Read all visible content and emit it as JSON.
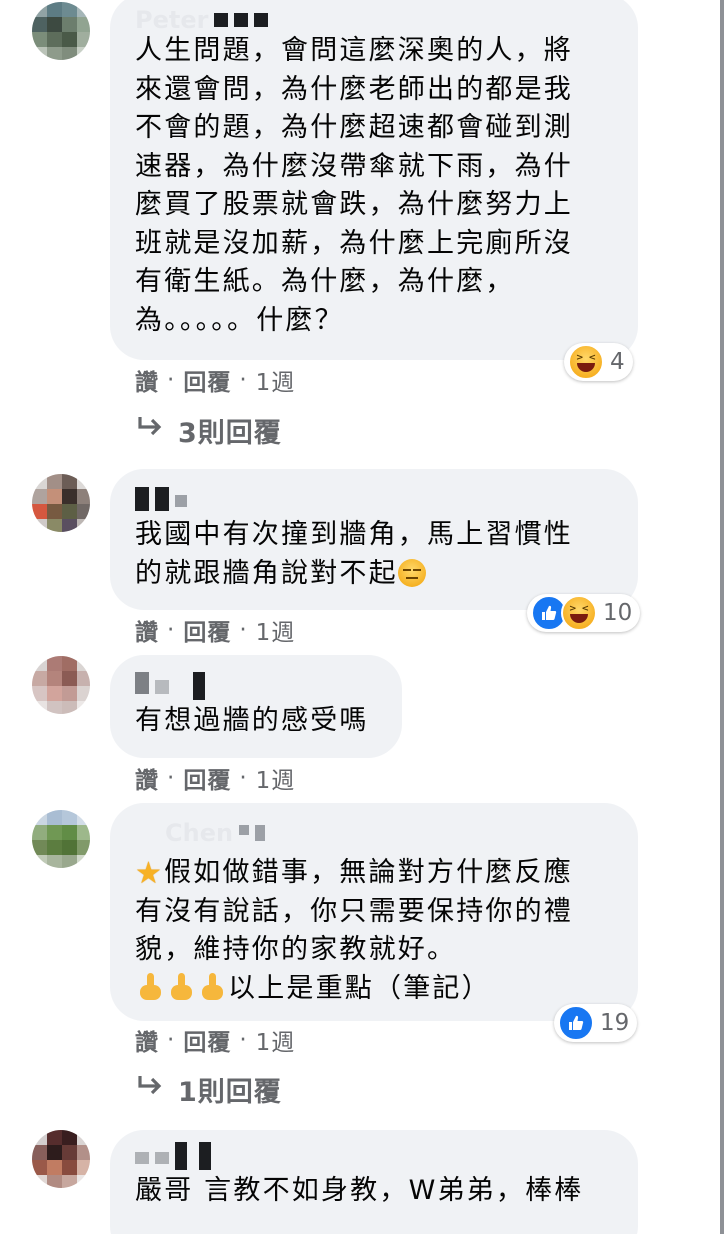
{
  "comments": [
    {
      "id": "c1",
      "name": "Peter",
      "text": "人生問題，會問這麼深奧的人，將\n來還會問，為什麼老師出的都是我\n不會的題，為什麼超速都會碰到測\n速器，為什麼沒帶傘就下雨，為什\n麼買了股票就會跌，為什麼努力上\n班就是沒加薪，為什麼上完廁所沒\n有衛生紙。為什麼，為什麼，\n為。。。。。什麼？",
      "reactions": [
        "haha"
      ],
      "reaction_count": "4",
      "actions": {
        "like": "讚",
        "reply": "回覆",
        "time": "1週"
      },
      "replies_label": "3則回覆"
    },
    {
      "id": "c2",
      "name": "",
      "text": "我國中有次撞到牆角，馬上習慣性\n的就跟牆角說對不起",
      "inline_emoji": "expressionless-face",
      "reactions": [
        "like",
        "haha"
      ],
      "reaction_count": "10",
      "actions": {
        "like": "讚",
        "reply": "回覆",
        "time": "1週"
      }
    },
    {
      "id": "c3",
      "name": "",
      "text": "有想過牆的感受嗎",
      "actions": {
        "like": "讚",
        "reply": "回覆",
        "time": "1週"
      }
    },
    {
      "id": "c4",
      "name": "Chen",
      "text_line1": "假如做錯事，無論對方什麼反應",
      "text_rest": "有沒有說話，你只需要保持你的禮\n貌，維持你的家教就好。",
      "text_last": "以上是重點（筆記）",
      "reactions": [
        "like"
      ],
      "reaction_count": "19",
      "actions": {
        "like": "讚",
        "reply": "回覆",
        "time": "1週"
      },
      "replies_label": "1則回覆"
    },
    {
      "id": "c5",
      "name": "",
      "text": "嚴哥 言教不如身教，W弟弟，棒棒"
    }
  ],
  "icons": {
    "reply_arrow": "reply-arrow-icon",
    "haha": "haha-reaction-icon",
    "like": "like-reaction-icon",
    "star": "star-emoji",
    "pointing": "backhand-index-pointing-down-emoji"
  },
  "colors": {
    "bubble": "#f0f2f5",
    "meta_text": "#65676b",
    "like_blue": "#1877f2",
    "haha_yellow": "#f7b125"
  }
}
